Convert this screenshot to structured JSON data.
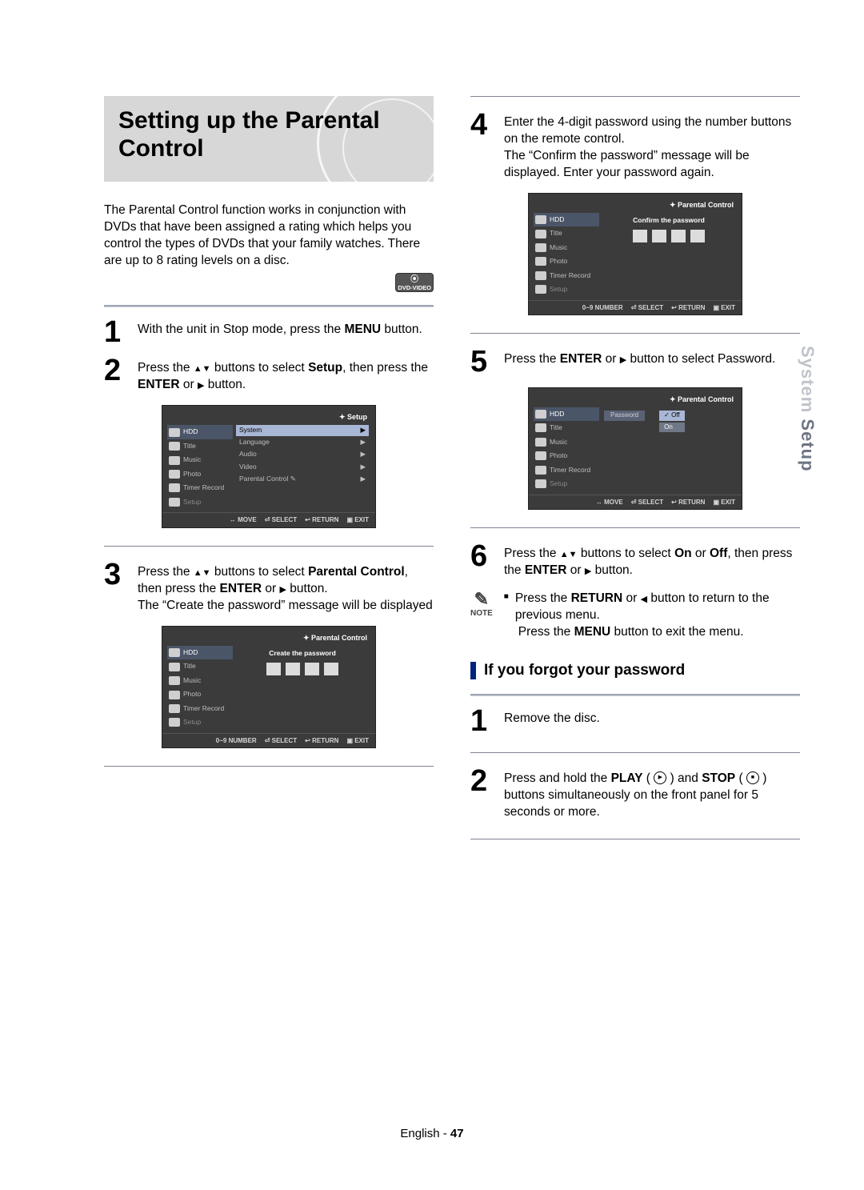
{
  "title": "Setting up the Parental Control",
  "intro": "The Parental Control function works in conjunction with DVDs that have been assigned a rating which helps you control the types of DVDs that your family watches. There are up to 8 rating levels on a disc.",
  "badge": "DVD-VIDEO",
  "side_tab": {
    "light": "System ",
    "dark": "Setup"
  },
  "footer": {
    "lang": "English",
    "sep": " - ",
    "page": "47"
  },
  "steps_left": [
    {
      "n": "1",
      "html": "With the unit in Stop mode, press the <b>MENU</b> button."
    },
    {
      "n": "2",
      "html": "Press the <span class='tri-up'></span><span class='tri-dn'></span> buttons to select <b>Setup</b>, then press the <b>ENTER</b> or <span class='tri-rt'></span> button."
    },
    {
      "n": "3",
      "html": "Press the <span class='tri-up'></span><span class='tri-dn'></span> buttons to select <b>Parental Control</b>, then press the <b>ENTER</b> or <span class='tri-rt'></span> button.<br>The “Create the password” message will be displayed"
    }
  ],
  "steps_right": [
    {
      "n": "4",
      "html": "Enter the 4-digit password using the number buttons on the remote control.<br>The “Confirm the password” message will be displayed. Enter your password again."
    },
    {
      "n": "5",
      "html": "Press the <b>ENTER</b> or <span class='tri-rt'></span> button to select Password."
    },
    {
      "n": "6",
      "html": "Press the <span class='tri-up'></span><span class='tri-dn'></span> buttons to select <b>On</b> or <b>Off</b>, then press the <b>ENTER</b> or <span class='tri-rt'></span> button."
    }
  ],
  "note": {
    "label": "NOTE",
    "lines": [
      "Press the <b>RETURN</b> or <span class='tri-lf'></span> button to return to the previous menu.",
      "Press the <b>MENU</b> button to exit the menu."
    ]
  },
  "forgot": {
    "heading": "If you forgot your password",
    "steps": [
      {
        "n": "1",
        "html": "Remove the disc."
      },
      {
        "n": "2",
        "html": "Press and hold the <b>PLAY</b> ( <span class='circ play'></span> ) and <b>STOP</b> ( <span class='circ stop'></span> ) buttons simultaneously on the front panel for 5 seconds or more."
      }
    ]
  },
  "osd_side": [
    "HDD",
    "Title",
    "Music",
    "Photo",
    "Timer Record",
    "Setup"
  ],
  "osd1": {
    "title": "Setup",
    "rows": [
      "System",
      "Language",
      "Audio",
      "Video",
      "Parental Control  ✎"
    ],
    "foot": [
      "↔ MOVE",
      "⏎ SELECT",
      "↩ RETURN",
      "▣ EXIT"
    ]
  },
  "osd2": {
    "title": "Parental Control",
    "msg": "Create the password",
    "foot": [
      "0~9 NUMBER",
      "⏎ SELECT",
      "↩ RETURN",
      "▣ EXIT"
    ]
  },
  "osd3": {
    "title": "Parental Control",
    "msg": "Confirm the password",
    "foot": [
      "0~9 NUMBER",
      "⏎ SELECT",
      "↩ RETURN",
      "▣ EXIT"
    ]
  },
  "osd4": {
    "title": "Parental Control",
    "col_label": "Password",
    "opts": [
      "Off",
      "On"
    ],
    "foot": [
      "↔ MOVE",
      "⏎ SELECT",
      "↩ RETURN",
      "▣ EXIT"
    ]
  }
}
